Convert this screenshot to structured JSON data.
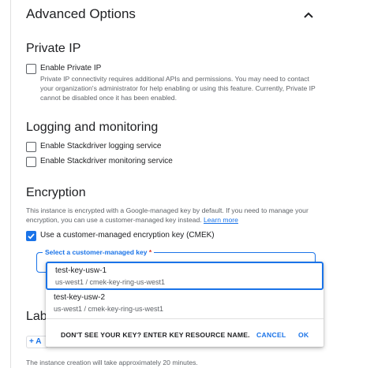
{
  "advanced_options": {
    "title": "Advanced Options",
    "collapse_icon": "chevron-up-icon"
  },
  "private_ip": {
    "heading": "Private IP",
    "checkbox_label": "Enable Private IP",
    "checked": false,
    "description": [
      "Private IP connectivity requires additional APIs and permissions. You may need to contact",
      "your organization's administrator for help enabling or using this feature. Currently, Private IP",
      "cannot be disabled once it has been enabled."
    ]
  },
  "logging": {
    "heading": "Logging and monitoring",
    "options": [
      {
        "label": "Enable Stackdriver logging service",
        "checked": false
      },
      {
        "label": "Enable Stackdriver monitoring service",
        "checked": false
      }
    ]
  },
  "encryption": {
    "heading": "Encryption",
    "description_line1": "This instance is encrypted with a Google-managed key by default. If you need to manage your",
    "description_line2": "encryption, you can use a customer-managed key instead.",
    "learn_more": "Learn more",
    "cmek_label": "Use a customer-managed encryption key (CMEK)",
    "cmek_checked": true,
    "select_label": "Select a customer-managed key",
    "required_marker": "*"
  },
  "key_dropdown": {
    "options": [
      {
        "name": "test-key-usw-1",
        "path": "us-west1 / cmek-key-ring-us-west1",
        "selected": true
      },
      {
        "name": "test-key-usw-2",
        "path": "us-west1 / cmek-key-ring-us-west1",
        "selected": false
      }
    ],
    "prompt": "DON'T SEE YOUR KEY? ENTER KEY RESOURCE NAME.",
    "cancel": "CANCEL",
    "ok": "OK"
  },
  "labels": {
    "heading_partial": "Lab",
    "add_button_partial": "+ A"
  },
  "footer": {
    "note": "The instance creation will take approximately 20 minutes."
  },
  "colors": {
    "accent": "#1a73e8",
    "required": "#d93025",
    "text_secondary": "#5f6368"
  }
}
